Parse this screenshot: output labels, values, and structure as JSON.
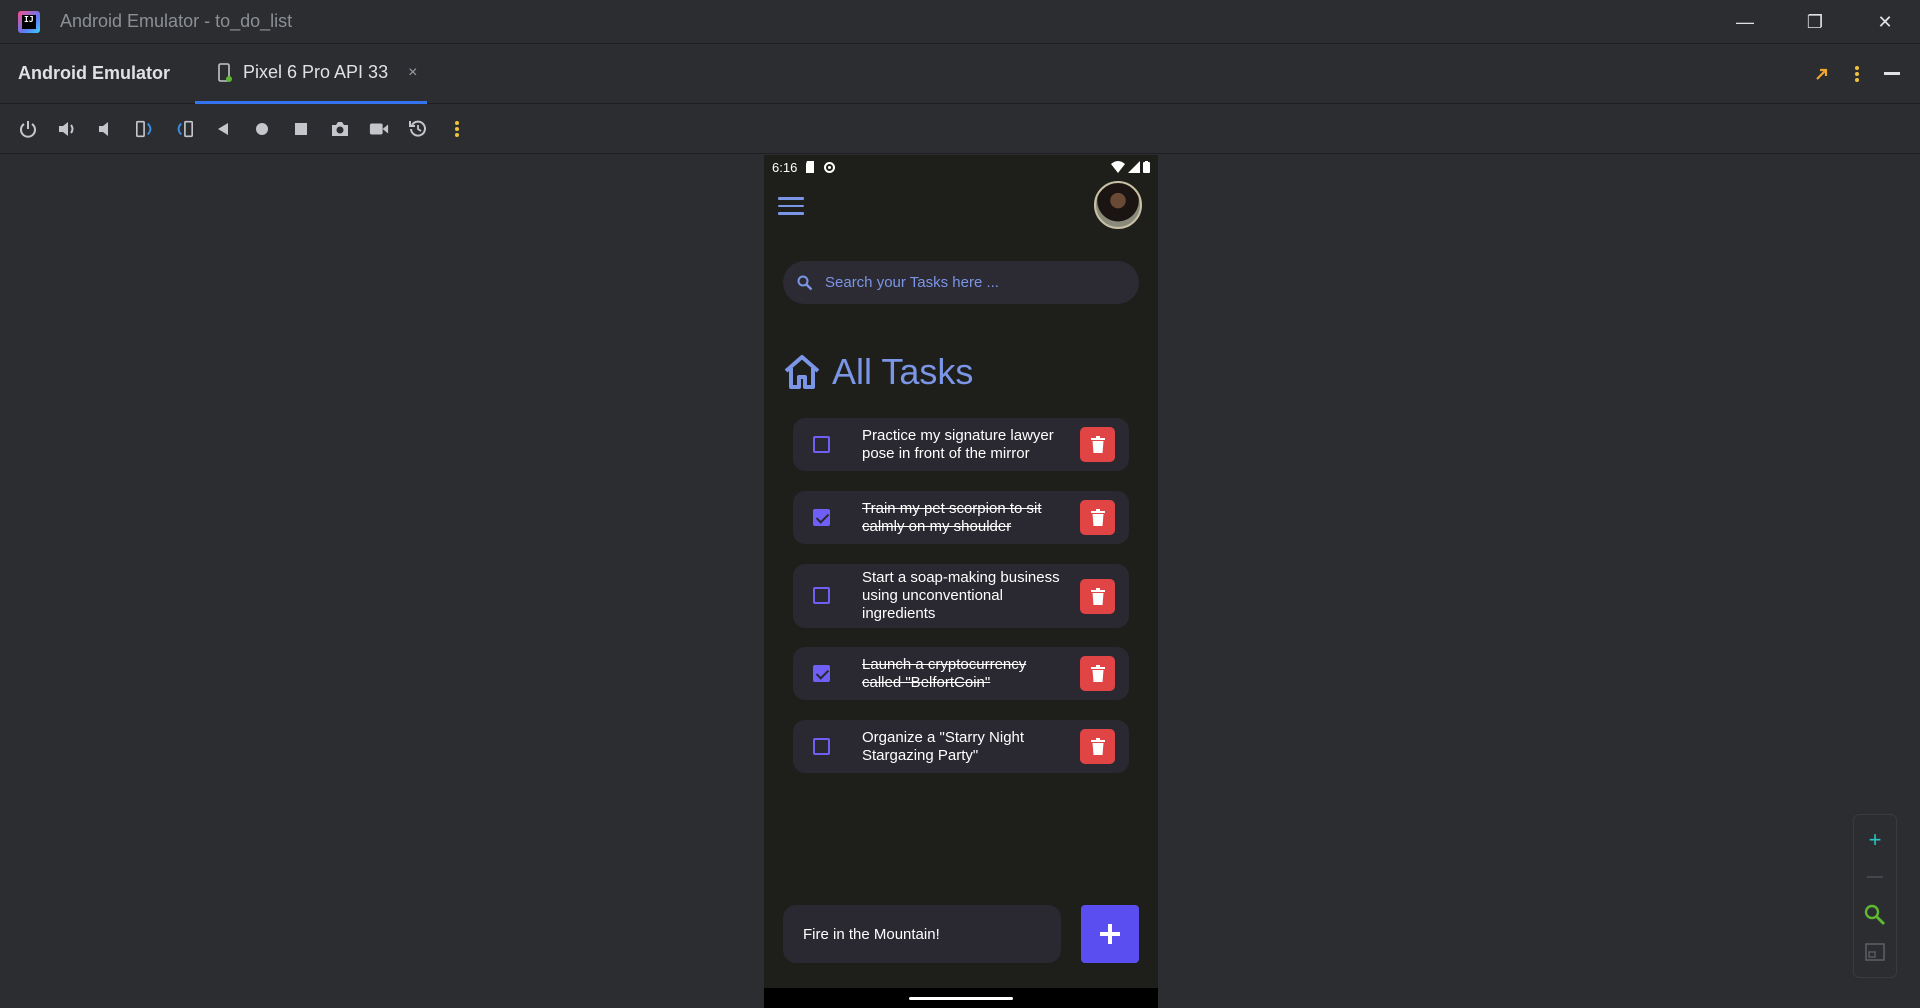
{
  "window": {
    "title": "Android Emulator - to_do_list",
    "minimize": "—",
    "restore": "❐",
    "close": "✕"
  },
  "tabbar": {
    "tool_name": "Android Emulator",
    "device_tab_label": "Pixel 6 Pro API 33",
    "close": "×"
  },
  "toolbar": {
    "icons": [
      "power-icon",
      "volume-up-icon",
      "volume-down-icon",
      "rotate-left-icon",
      "rotate-right-icon",
      "back-icon",
      "home-icon",
      "overview-icon",
      "camera-icon",
      "record-icon",
      "reset-icon",
      "more-icon"
    ]
  },
  "phone": {
    "status_time": "6:16",
    "search_placeholder": "Search your Tasks here ...",
    "heading": "All Tasks",
    "tasks": [
      {
        "text": "Practice my signature lawyer pose in front of the mirror",
        "done": false
      },
      {
        "text": "Train my pet scorpion to sit calmly on my shoulder",
        "done": true
      },
      {
        "text": "Start a soap-making business using unconventional ingredients",
        "done": false
      },
      {
        "text": "Launch a cryptocurrency called \"BelfortCoin\"",
        "done": true
      },
      {
        "text": "Organize a \"Starry Night Stargazing Party\"",
        "done": false
      }
    ],
    "input_value": "Fire in the Mountain!",
    "add_label": "+"
  },
  "zoom": {
    "plus": "+",
    "minus": "—"
  },
  "colors": {
    "accent": "#7b96e6",
    "checkbox": "#6f5ff5",
    "delete": "#e04444",
    "add": "#5b4ef0"
  }
}
